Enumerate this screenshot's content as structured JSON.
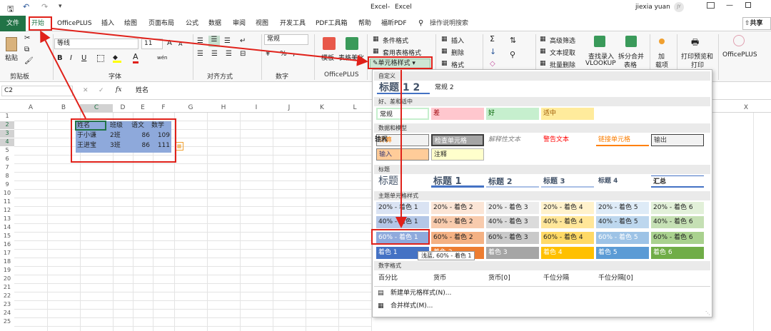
{
  "title": {
    "file": "Excel",
    "app": "Excel",
    "user": "jiexia yuan",
    "user_initials": "JY",
    "share": "共享"
  },
  "tabs": [
    "文件",
    "开始",
    "OfficePLUS",
    "插入",
    "绘图",
    "页面布局",
    "公式",
    "数据",
    "审阅",
    "视图",
    "开发工具",
    "PDF工具箱",
    "帮助",
    "福昕PDF"
  ],
  "tell_me": "操作说明搜索",
  "ribbon": {
    "clipboard": {
      "paste": "粘贴",
      "group": "剪贴板"
    },
    "font": {
      "name": "等线",
      "size": "11",
      "bold": "B",
      "italic": "I",
      "underline": "U",
      "group": "字体",
      "grow": "A",
      "shrink": "A",
      "phonetic": "wén"
    },
    "align": {
      "group": "对齐方式"
    },
    "number": {
      "format": "常规",
      "group": "数字"
    },
    "officeplus": {
      "template": "模板",
      "beautify": "表格美化",
      "group": "OfficePLUS"
    },
    "styles": {
      "conditional": "条件格式",
      "table": "套用表格格式",
      "cell": "单元格样式"
    },
    "cells": {
      "insert": "插入",
      "delete": "删除",
      "format": "格式"
    },
    "editing": {
      "sum": "Σ",
      "fill": "↓",
      "clear": "◇"
    },
    "tools": {
      "adv_filter": "高级筛选",
      "text_extract": "文本提取",
      "batch_delete": "批量删除",
      "lookup1": "查找录入",
      "lookup2": "VLOOKUP",
      "split1": "拆分合并",
      "split2": "表格",
      "add1": "加",
      "add2": "载项",
      "print1": "打印预览和",
      "print2": "打印",
      "op": "OfficePLUS"
    }
  },
  "formula": {
    "name_box": "C2",
    "fx": "fx",
    "value": "姓名"
  },
  "columns": [
    "A",
    "B",
    "C",
    "D",
    "E",
    "F",
    "G",
    "H",
    "I",
    "J",
    "K",
    "L",
    "M",
    "N",
    "O",
    "P",
    "Q",
    "R",
    "S",
    "T",
    "U",
    "V",
    "W",
    "X"
  ],
  "rows": [
    "1",
    "2",
    "3",
    "4",
    "5",
    "6",
    "7",
    "8",
    "9",
    "10",
    "11",
    "12",
    "13",
    "14",
    "15",
    "16",
    "17",
    "18",
    "19",
    "20",
    "21",
    "22",
    "23",
    "24",
    "25"
  ],
  "table": {
    "headers": [
      "姓名",
      "班级",
      "语文",
      "数学"
    ],
    "rows": [
      [
        "于小谦",
        "2班",
        "86",
        "109"
      ],
      [
        "王进宝",
        "3班",
        "86",
        "111"
      ]
    ]
  },
  "menu": {
    "custom": {
      "section": "自定义",
      "items": [
        "标题 1 2",
        "常规 2"
      ]
    },
    "good_bad": {
      "section": "好、差和适中",
      "items": [
        "常规",
        "差",
        "好",
        "适中"
      ]
    },
    "data_model": {
      "section": "数据和模型",
      "items": [
        "计算",
        "检查单元格",
        "解释性文本",
        "警告文本",
        "链接单元格",
        "输出",
        "输入",
        "注释"
      ]
    },
    "titles": {
      "section": "标题",
      "items": [
        "标题",
        "标题 1",
        "标题 2",
        "标题 3",
        "标题 4",
        "汇总"
      ]
    },
    "theme": {
      "section": "主题单元格样式",
      "r20": [
        "20% - 着色 1",
        "20% - 着色 2",
        "20% - 着色 3",
        "20% - 着色 4",
        "20% - 着色 5",
        "20% - 着色 6"
      ],
      "r40": [
        "40% - 着色 1",
        "40% - 着色 2",
        "40% - 着色 3",
        "40% - 着色 4",
        "40% - 着色 5",
        "40% - 着色 6"
      ],
      "r60": [
        "60% - 着色 1",
        "60% - 着色 2",
        "60% - 着色 3",
        "60% - 着色 4",
        "60% - 着色 5",
        "60% - 着色 6"
      ],
      "full": [
        "着色 1",
        "着色 2",
        "着色 3",
        "着色 4",
        "着色 5",
        "着色 6"
      ]
    },
    "number": {
      "section": "数字格式",
      "items": [
        "百分比",
        "货币",
        "货币[0]",
        "千位分隔",
        "千位分隔[0]"
      ]
    },
    "new_style": "新建单元格样式(N)...",
    "merge_style": "合并样式(M)...",
    "tooltip": "浅蓝, 60% - 着色 1"
  },
  "colors": {
    "accent": "#217346",
    "highlight": "#e0211a",
    "cell_fill": "#8ea9db"
  }
}
